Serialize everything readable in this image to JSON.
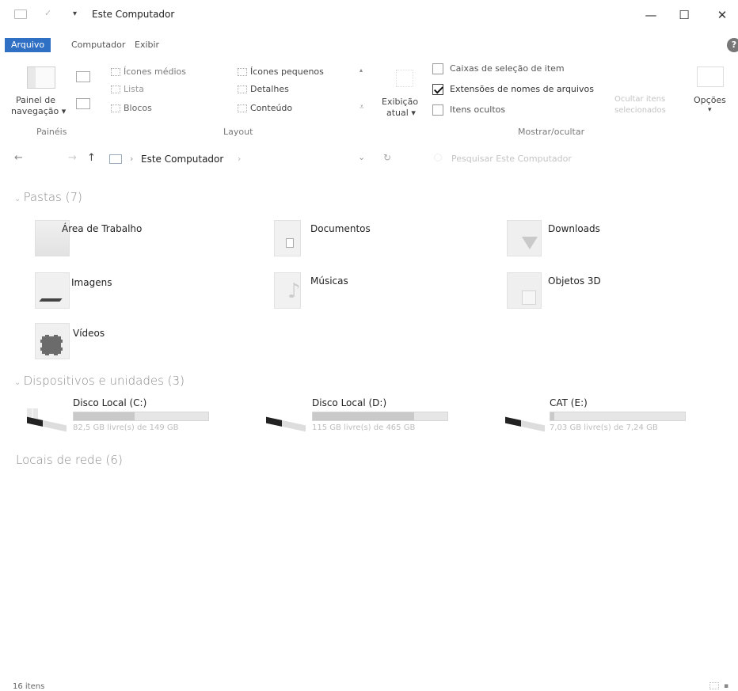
{
  "window": {
    "title": "Este Computador",
    "controls": {
      "minimize": "—",
      "maximize": "☐",
      "close": "✕"
    }
  },
  "tabs": [
    {
      "label": "Arquivo"
    },
    {
      "label": "Computador"
    },
    {
      "label": "Exibir"
    }
  ],
  "ribbon": {
    "paineis": {
      "button": "Painel de",
      "button2": "navegação ▾",
      "group": "Painéis"
    },
    "layout": {
      "items": [
        "Ícones médios",
        "Lista",
        "Blocos",
        "Ícones pequenos",
        "Detalhes",
        "Conteúdo"
      ],
      "group": "Layout"
    },
    "exibicao": {
      "line1": "Exibição",
      "line2": "atual ▾"
    },
    "mostrar": {
      "checks": [
        {
          "label": "Caixas de seleção de item",
          "checked": false
        },
        {
          "label": "Extensões de nomes de arquivos",
          "checked": true
        },
        {
          "label": "Itens ocultos",
          "checked": false
        }
      ],
      "ocultar1": "Ocultar itens",
      "ocultar2": "selecionados",
      "group": "Mostrar/ocultar"
    },
    "opcoes": {
      "label": "Opções",
      "arrow": "▾"
    },
    "help": "?"
  },
  "address": {
    "back": "←",
    "forward": "→",
    "up": "↑",
    "sep": "›",
    "path": "Este Computador",
    "sep2": "›",
    "dropdown": "⌄",
    "refresh": "↻",
    "search_placeholder": "Pesquisar Este Computador"
  },
  "sections": {
    "pastas": "Pastas (7)",
    "dispositivos": "Dispositivos e unidades (3)",
    "rede": "Locais de rede (6)"
  },
  "folders": [
    {
      "name": "Área de Trabalho",
      "icon": "desktop-folder-icon"
    },
    {
      "name": "Documentos",
      "icon": "documents-folder-icon"
    },
    {
      "name": "Downloads",
      "icon": "downloads-folder-icon"
    },
    {
      "name": "Imagens",
      "icon": "pictures-folder-icon"
    },
    {
      "name": "Músicas",
      "icon": "music-folder-icon"
    },
    {
      "name": "Objetos 3D",
      "icon": "3d-objects-folder-icon"
    },
    {
      "name": "Vídeos",
      "icon": "videos-folder-icon"
    }
  ],
  "drives": [
    {
      "name": "Disco Local (C:)",
      "free": "82,5 GB livre(s) de 149 GB",
      "used_fraction": 0.45
    },
    {
      "name": "Disco Local (D:)",
      "free": "115 GB livre(s) de 465 GB",
      "used_fraction": 0.75
    },
    {
      "name": "CAT (E:)",
      "free": "7,03 GB livre(s) de 7,24 GB",
      "used_fraction": 0.03
    }
  ],
  "status": {
    "count": "16 itens"
  }
}
